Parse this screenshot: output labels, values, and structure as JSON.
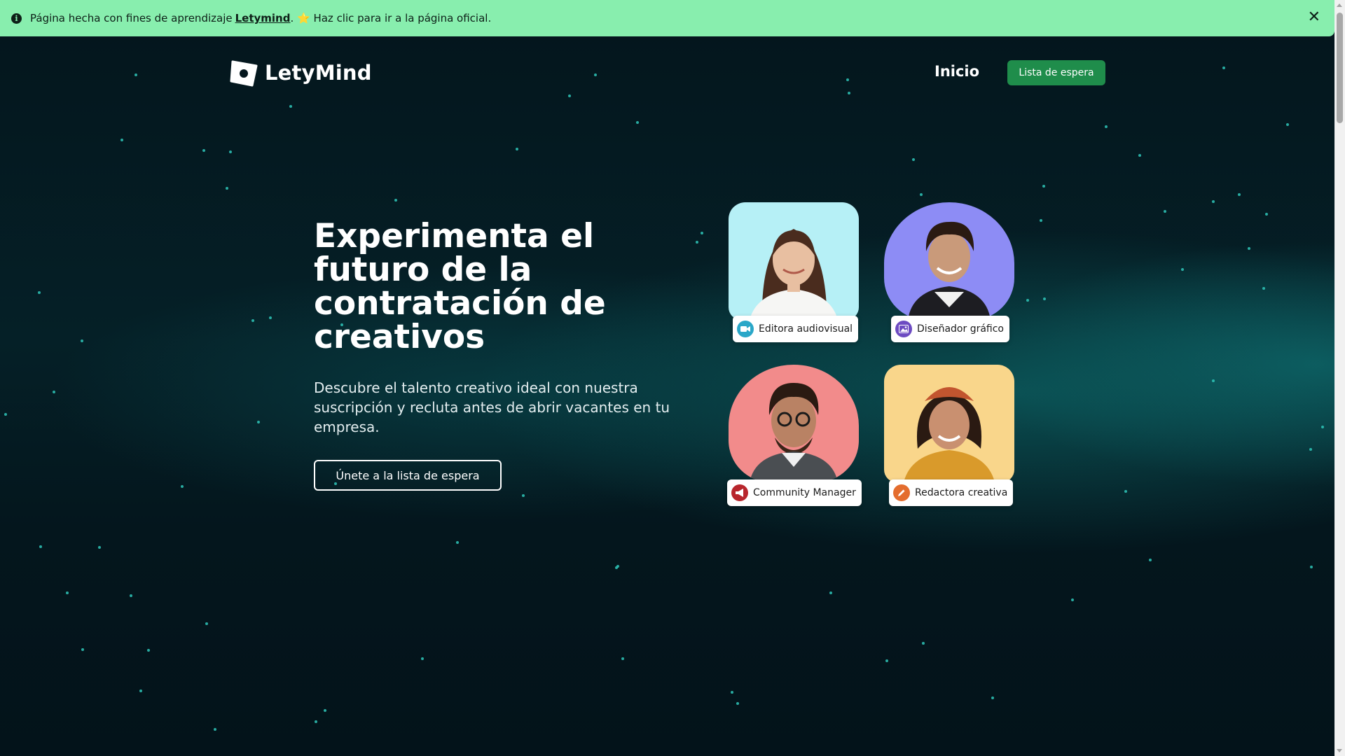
{
  "notice": {
    "text_before": "Página hecha con fines de aprendizaje",
    "link": "Letymind",
    "text_after": ". ⭐ Haz clic para ir a la página oficial.",
    "close_symbol": "✕",
    "info_symbol": "i"
  },
  "header": {
    "brand": "LetyMind",
    "nav_home": "Inicio",
    "nav_cta": "Lista de espera"
  },
  "hero": {
    "title": "Experimenta el futuro de la contratación de creativos",
    "description": "Descubre el talento creativo ideal con nuestra suscripción y recluta antes de abrir vacantes en tu empresa.",
    "cta": "Únete a la lista de espera"
  },
  "cards": [
    {
      "role": "Editora audiovisual",
      "icon": "video-camera-icon",
      "bg": "#b6f0f6",
      "icon_color": "#2aa7c8"
    },
    {
      "role": "Diseñador gráfico",
      "icon": "image-icon",
      "bg": "#8d8cf5",
      "icon_color": "#6d4bc2"
    },
    {
      "role": "Community Manager",
      "icon": "megaphone-icon",
      "bg": "#f28b8b",
      "icon_color": "#b8262d"
    },
    {
      "role": "Redactora creativa",
      "icon": "pencil-icon",
      "bg": "#f9d68b",
      "icon_color": "#e46d2e"
    }
  ],
  "colors": {
    "notice_bg": "#88eeae",
    "cta_green": "#1f8d4b",
    "background": "#04161d",
    "star": "#2fc5b8"
  }
}
